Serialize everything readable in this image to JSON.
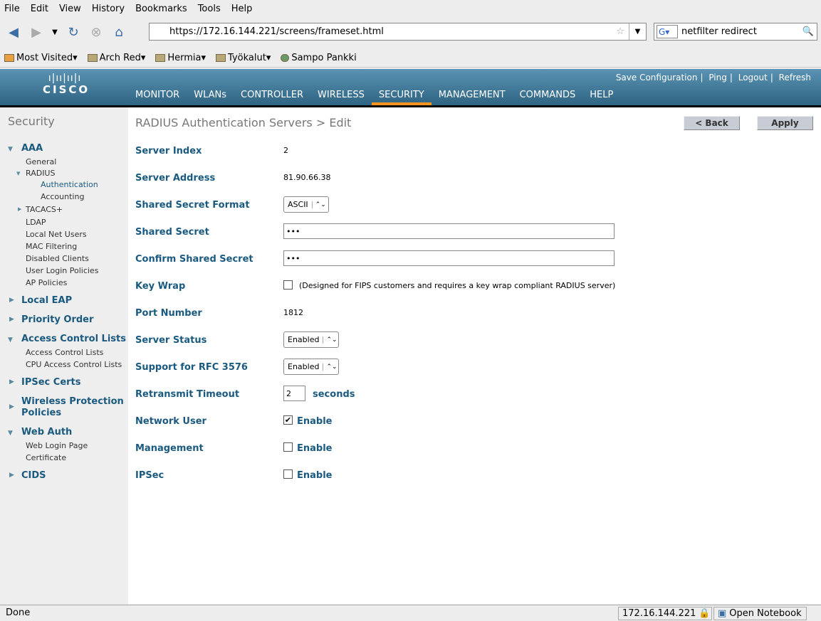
{
  "browser": {
    "menu": [
      "File",
      "Edit",
      "View",
      "History",
      "Bookmarks",
      "Tools",
      "Help"
    ],
    "url": "https://172.16.144.221/screens/frameset.html",
    "search": "netfilter redirect",
    "bookmarks": [
      "Most Visited",
      "Arch Red",
      "Hermia",
      "Työkalut",
      "Sampo Pankki"
    ],
    "status": "Done",
    "status_host": "172.16.144.221",
    "status_notebook": "Open Notebook"
  },
  "header": {
    "logo": "CISCO",
    "nav": [
      "MONITOR",
      "WLANs",
      "CONTROLLER",
      "WIRELESS",
      "SECURITY",
      "MANAGEMENT",
      "COMMANDS",
      "HELP"
    ],
    "active": "SECURITY",
    "links": [
      "Save Configuration",
      "Ping",
      "Logout",
      "Refresh"
    ],
    "accent": "#f7941d"
  },
  "sidebar": {
    "title": "Security",
    "items": [
      "AAA",
      "General",
      "RADIUS",
      "Authentication",
      "Accounting",
      "TACACS+",
      "LDAP",
      "Local Net Users",
      "MAC Filtering",
      "Disabled Clients",
      "User Login Policies",
      "AP Policies",
      "Local EAP",
      "Priority Order",
      "Access Control Lists",
      "Access Control Lists",
      "CPU Access Control Lists",
      "IPSec Certs",
      "Wireless Protection",
      "Policies",
      "Web Auth",
      "Web Login Page",
      "Certificate",
      "CIDS"
    ]
  },
  "page": {
    "title": "RADIUS Authentication Servers > Edit",
    "back": "< Back",
    "apply": "Apply",
    "fields": {
      "server_index": {
        "label": "Server Index",
        "value": "2"
      },
      "server_address": {
        "label": "Server Address",
        "value": "81.90.66.38"
      },
      "secret_format": {
        "label": "Shared Secret Format",
        "value": "ASCII"
      },
      "secret": {
        "label": "Shared Secret",
        "value": "•••"
      },
      "confirm_secret": {
        "label": "Confirm Shared Secret",
        "value": "•••"
      },
      "key_wrap": {
        "label": "Key Wrap",
        "checked": false,
        "note": "(Designed for FIPS customers and requires a key wrap compliant RADIUS server)"
      },
      "port": {
        "label": "Port Number",
        "value": "1812"
      },
      "server_status": {
        "label": "Server Status",
        "value": "Enabled"
      },
      "rfc3576": {
        "label": "Support for RFC 3576",
        "value": "Enabled"
      },
      "timeout": {
        "label": "Retransmit Timeout",
        "value": "2",
        "unit": "seconds"
      },
      "network_user": {
        "label": "Network User",
        "checked": true,
        "option": "Enable"
      },
      "management": {
        "label": "Management",
        "checked": false,
        "option": "Enable"
      },
      "ipsec": {
        "label": "IPSec",
        "checked": false,
        "option": "Enable"
      }
    }
  }
}
